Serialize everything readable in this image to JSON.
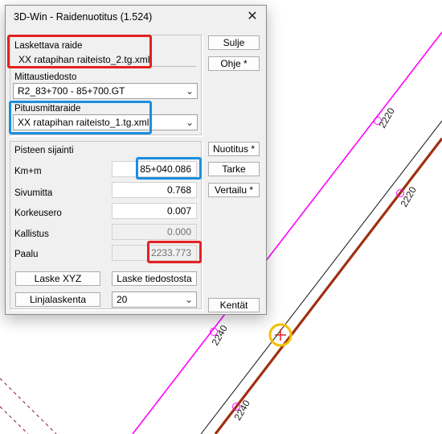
{
  "colors": {
    "red_highlight": "#e42020",
    "blue_highlight": "#1a8fe0",
    "magenta_line": "#ff00ff",
    "track_line": "#a03010",
    "marker": "#f0c000"
  },
  "map": {
    "labels": [
      "2220",
      "2220",
      "2240",
      "2240"
    ]
  },
  "dialog": {
    "title": "3D-Win - Raidenuotitus  (1.524)",
    "close_icon": "close-icon",
    "laskettava_raide_label": "Laskettava raide",
    "laskettava_raide_value": "XX ratapihan raiteisto_2.tg.xml",
    "mittaustiedosto_label": "Mittaustiedosto",
    "mittaustiedosto_value": "R2_83+700 - 85+700.GT",
    "pituusmittaraide_label": "Pituusmittaraide",
    "pituusmittaraide_value": "XX ratapihan raiteisto_1.tg.xml",
    "pisteen_sijainti_label": "Pisteen sijainti",
    "fields": {
      "kmm_label": "Km+m",
      "kmm_value": "85+040.086",
      "sivumitta_label": "Sivumitta",
      "sivumitta_value": "0.768",
      "korkeusero_label": "Korkeusero",
      "korkeusero_value": "0.007",
      "kallistus_label": "Kallistus",
      "kallistus_value": "0.000",
      "paalu_label": "Paalu",
      "paalu_value": "2233.773"
    },
    "buttons": {
      "sulje": "Sulje",
      "ohje": "Ohje *",
      "nuotitus": "Nuotitus *",
      "tarke": "Tarke",
      "vertailu": "Vertailu *",
      "laske_xyz": "Laske XYZ",
      "laske_tiedostosta": "Laske tiedostosta",
      "linjalaskenta": "Linjalaskenta",
      "kentat": "Kentät"
    },
    "linjalaskenta_value": "20"
  }
}
